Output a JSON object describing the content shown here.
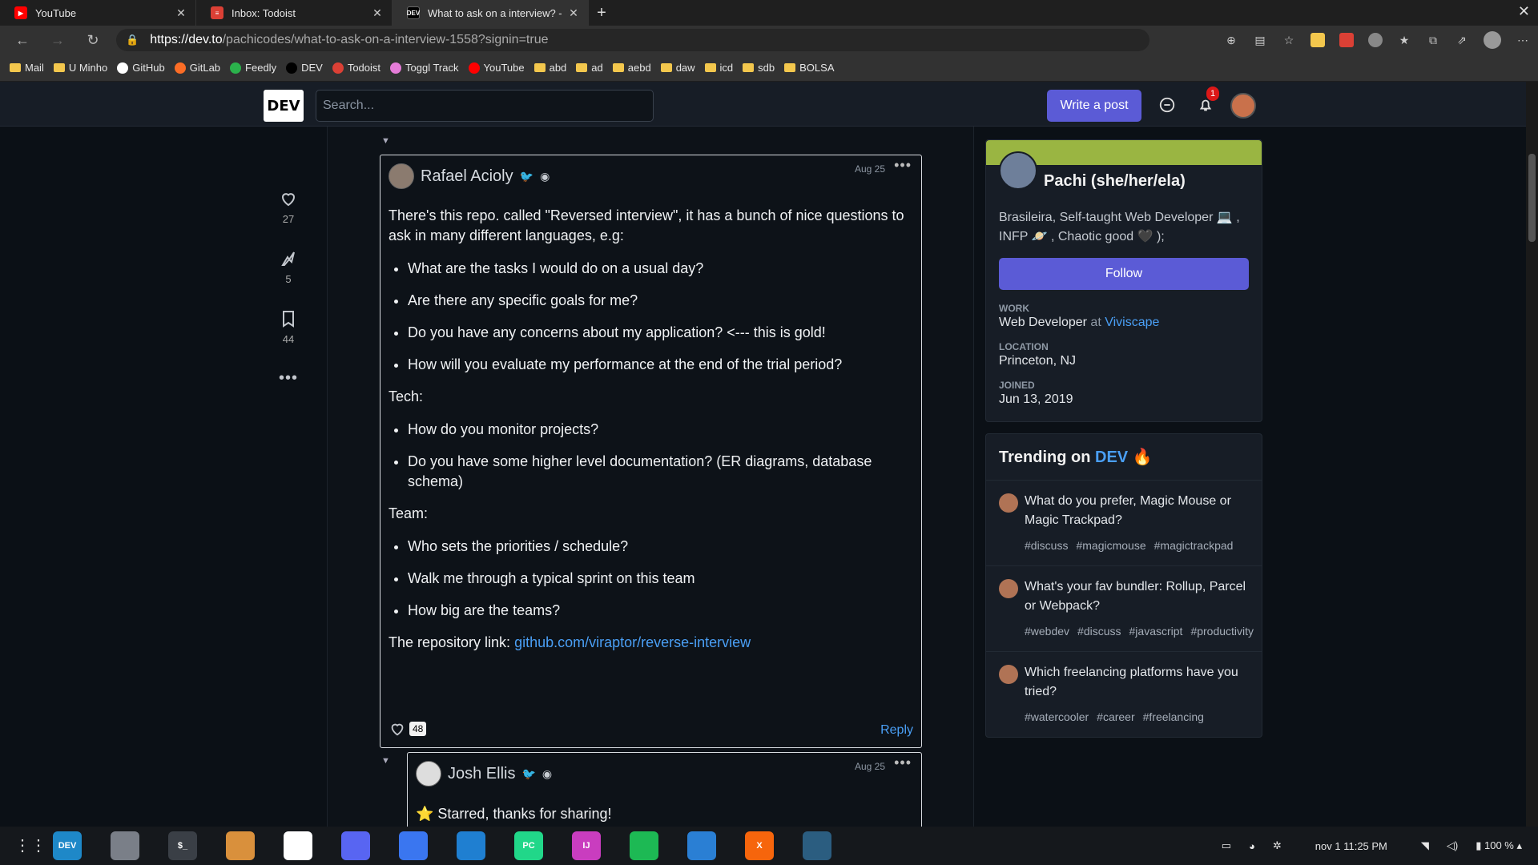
{
  "browser": {
    "tabs": [
      {
        "title": "YouTube",
        "icon": "youtube-icon",
        "color": "#ff0000"
      },
      {
        "title": "Inbox: Todoist",
        "icon": "todoist-icon",
        "color": "#db4035"
      },
      {
        "title": "What to ask on a interview? -",
        "icon": "dev-icon",
        "color": "#000000"
      }
    ],
    "url_host": "https://dev.to",
    "url_rest": "/pachicodes/what-to-ask-on-a-interview-1558?signin=true",
    "bookmarks": [
      {
        "label": "Mail",
        "type": "folder"
      },
      {
        "label": "U Minho",
        "type": "folder"
      },
      {
        "label": "GitHub",
        "type": "site",
        "color": "#ffffff"
      },
      {
        "label": "GitLab",
        "type": "site",
        "color": "#fc6d26"
      },
      {
        "label": "Feedly",
        "type": "site",
        "color": "#2bb24c"
      },
      {
        "label": "DEV",
        "type": "site",
        "color": "#000000"
      },
      {
        "label": "Todoist",
        "type": "site",
        "color": "#db4035"
      },
      {
        "label": "Toggl Track",
        "type": "site",
        "color": "#e57cd8"
      },
      {
        "label": "YouTube",
        "type": "site",
        "color": "#ff0000"
      },
      {
        "label": "abd",
        "type": "folder"
      },
      {
        "label": "ad",
        "type": "folder"
      },
      {
        "label": "aebd",
        "type": "folder"
      },
      {
        "label": "daw",
        "type": "folder"
      },
      {
        "label": "icd",
        "type": "folder"
      },
      {
        "label": "sdb",
        "type": "folder"
      },
      {
        "label": "BOLSA",
        "type": "folder"
      }
    ]
  },
  "header": {
    "logo": "DEV",
    "search_placeholder": "Search...",
    "write_label": "Write a post",
    "notif_count": "1"
  },
  "rail": {
    "likes": "27",
    "unicorns": "5",
    "saves": "44"
  },
  "comment": {
    "author": "Rafael Acioly",
    "date": "Aug 25",
    "intro": "There's this repo. called \"Reversed interview\", it has a bunch of nice questions to ask in many different languages, e.g:",
    "list1": [
      "What are the tasks I would do on a usual day?",
      "Are there any specific goals for me?",
      "Do you have any concerns about my application? <--- this is gold!",
      "How will you evaluate my performance at the end of the trial period?"
    ],
    "tech_label": "Tech:",
    "list2": [
      "How do you monitor projects?",
      "Do you have some higher level documentation? (ER diagrams, database schema)"
    ],
    "team_label": "Team:",
    "list3": [
      "Who sets the priorities / schedule?",
      "Walk me through a typical sprint on this team",
      "How big are the teams?"
    ],
    "repo_prefix": "The repository link: ",
    "repo_link": "github.com/viraptor/reverse-interview",
    "likes": "48",
    "reply": "Reply"
  },
  "reply_comment": {
    "author": "Josh Ellis",
    "date": "Aug 25",
    "body": "⭐ Starred, thanks for sharing!"
  },
  "profile": {
    "name": "Pachi (she/her/ela)",
    "bio": "Brasileira, Self-taught Web Developer 💻 , INFP 🪐 , Chaotic good 🖤 );",
    "follow": "Follow",
    "work_key": "WORK",
    "work_role": "Web Developer",
    "work_at": " at ",
    "work_company": "Viviscape",
    "location_key": "LOCATION",
    "location": "Princeton, NJ",
    "joined_key": "JOINED",
    "joined": "Jun 13, 2019"
  },
  "trending": {
    "heading_prefix": "Trending on ",
    "heading_dev": "DEV",
    "heading_emoji": "🔥",
    "items": [
      {
        "title": "What do you prefer, Magic Mouse or Magic Trackpad?",
        "tags": [
          "#discuss",
          "#magicmouse",
          "#magictrackpad"
        ]
      },
      {
        "title": "What's your fav bundler: Rollup, Parcel or Webpack?",
        "tags": [
          "#webdev",
          "#discuss",
          "#javascript",
          "#productivity"
        ]
      },
      {
        "title": "Which freelancing platforms have you tried?",
        "tags": [
          "#watercooler",
          "#career",
          "#freelancing"
        ]
      }
    ]
  },
  "taskbar": {
    "apps": [
      {
        "name": "edge-icon",
        "color": "#1e88c8",
        "label": "DEV"
      },
      {
        "name": "files-icon",
        "color": "#7a7f88",
        "label": ""
      },
      {
        "name": "terminal-icon",
        "color": "#3a3f46",
        "label": "$_"
      },
      {
        "name": "installer-icon",
        "color": "#d9903c",
        "label": ""
      },
      {
        "name": "slack-icon",
        "color": "#ffffff",
        "label": ""
      },
      {
        "name": "discord-icon",
        "color": "#5865f2",
        "label": ""
      },
      {
        "name": "signal-icon",
        "color": "#3a76f0",
        "label": ""
      },
      {
        "name": "vscode-icon",
        "color": "#1f7fd1",
        "label": ""
      },
      {
        "name": "pycharm-icon",
        "color": "#21d789",
        "label": "PC"
      },
      {
        "name": "intellij-icon",
        "color": "#c93dbf",
        "label": "IJ"
      },
      {
        "name": "spotify-icon",
        "color": "#1db954",
        "label": ""
      },
      {
        "name": "monitor-icon",
        "color": "#2a7fd4",
        "label": ""
      },
      {
        "name": "xampp-icon",
        "color": "#f6650c",
        "label": "X"
      },
      {
        "name": "mysql-workbench-icon",
        "color": "#2b5d80",
        "label": ""
      }
    ],
    "datetime": "nov 1  11:25 PM",
    "battery": "100 %"
  }
}
